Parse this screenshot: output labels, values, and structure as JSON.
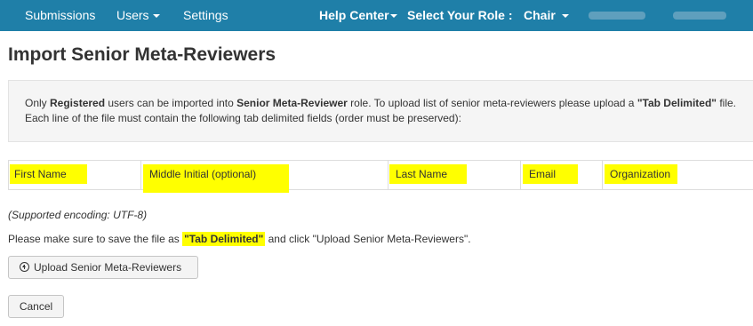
{
  "navbar": {
    "left_items": [
      {
        "label": "Submissions"
      },
      {
        "label": "Users"
      },
      {
        "label": "Settings"
      }
    ],
    "help_center": "Help Center",
    "select_role_label": "Select Your Role :",
    "role_value": "Chair",
    "background_color": "#1f7fa8"
  },
  "page": {
    "title": "Import Senior Meta-Reviewers"
  },
  "info": {
    "p1": "Only ",
    "b1": "Registered",
    "p2": " users can be imported into ",
    "b2": "Senior Meta-Reviewer",
    "p3": " role. To upload list of senior meta-reviewers please upload a ",
    "b3": "\"Tab Delimited\"",
    "p4": " file. Each line of the file must contain the following tab delimited fields (order must be preserved):"
  },
  "fields": [
    "First Name",
    "Middle Initial (optional)",
    "Last Name",
    "Email",
    "Organization"
  ],
  "encoding_note": "(Supported encoding: UTF-8)",
  "instruction": {
    "before": "Please make sure to save the file as ",
    "highlight": "\"Tab Delimited\"",
    "after": " and click \"Upload Senior Meta-Reviewers\"."
  },
  "buttons": {
    "upload_label": "Upload Senior Meta-Reviewers",
    "cancel_label": "Cancel"
  },
  "colors": {
    "highlight": "#ffff00",
    "panel_background": "#f5f5f5"
  },
  "icons": {
    "upload": "circle-arrow-up-icon",
    "dropdown": "caret-down-icon"
  }
}
